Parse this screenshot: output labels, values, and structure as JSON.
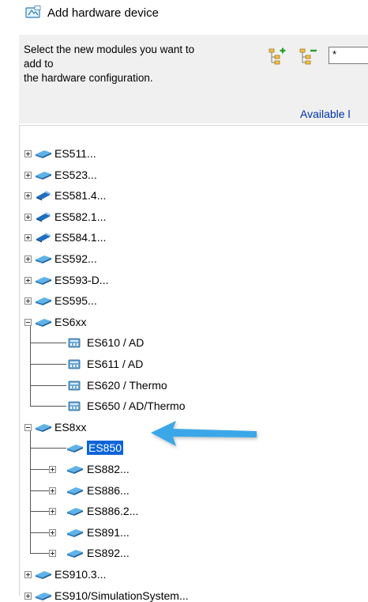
{
  "window": {
    "title": "Add hardware device"
  },
  "header": {
    "instruction_lines": [
      "Select the new modules you want to",
      "add to",
      "the hardware configuration."
    ],
    "filter_value": "*",
    "available_label": "Available l"
  },
  "toolbar": {
    "add_icon": "add-module-icon",
    "remove_icon": "remove-module-icon"
  },
  "tree": {
    "items": [
      {
        "label": "ES511...",
        "level": 0,
        "expander": "plus",
        "icon": "module-icon",
        "selected": false
      },
      {
        "label": "ES523...",
        "level": 0,
        "expander": "plus",
        "icon": "module-icon",
        "selected": false
      },
      {
        "label": "ES581.4...",
        "level": 0,
        "expander": "plus",
        "icon": "usb-module-icon",
        "selected": false
      },
      {
        "label": "ES582.1...",
        "level": 0,
        "expander": "plus",
        "icon": "usb-module-icon",
        "selected": false
      },
      {
        "label": "ES584.1...",
        "level": 0,
        "expander": "plus",
        "icon": "usb-module-icon",
        "selected": false
      },
      {
        "label": "ES592...",
        "level": 0,
        "expander": "plus",
        "icon": "module-icon",
        "selected": false
      },
      {
        "label": "ES593-D...",
        "level": 0,
        "expander": "plus",
        "icon": "module-icon",
        "selected": false
      },
      {
        "label": "ES595...",
        "level": 0,
        "expander": "plus",
        "icon": "module-icon",
        "selected": false
      },
      {
        "label": "ES6xx",
        "level": 0,
        "expander": "minus",
        "icon": "module-icon",
        "selected": false
      },
      {
        "label": "ES610 / AD",
        "level": 1,
        "expander": "none",
        "icon": "measurement-module-icon",
        "selected": false
      },
      {
        "label": "ES611 / AD",
        "level": 1,
        "expander": "none",
        "icon": "measurement-module-icon",
        "selected": false
      },
      {
        "label": "ES620 / Thermo",
        "level": 1,
        "expander": "none",
        "icon": "measurement-module-icon",
        "selected": false
      },
      {
        "label": "ES650 / AD/Thermo",
        "level": 1,
        "expander": "none",
        "icon": "measurement-module-icon",
        "selected": false
      },
      {
        "label": "ES8xx",
        "level": 0,
        "expander": "minus",
        "icon": "module-icon",
        "selected": false
      },
      {
        "label": "ES850",
        "level": 1,
        "expander": "none",
        "icon": "module-icon",
        "selected": true
      },
      {
        "label": "ES882...",
        "level": 1,
        "expander": "plus",
        "icon": "module-icon",
        "selected": false
      },
      {
        "label": "ES886...",
        "level": 1,
        "expander": "plus",
        "icon": "module-icon",
        "selected": false
      },
      {
        "label": "ES886.2...",
        "level": 1,
        "expander": "plus",
        "icon": "module-icon",
        "selected": false
      },
      {
        "label": "ES891...",
        "level": 1,
        "expander": "plus",
        "icon": "module-icon",
        "selected": false
      },
      {
        "label": "ES892...",
        "level": 1,
        "expander": "plus",
        "icon": "module-icon",
        "selected": false
      },
      {
        "label": "ES910.3...",
        "level": 0,
        "expander": "plus",
        "icon": "module-icon",
        "selected": false
      },
      {
        "label": "ES910/SimulationSystem...",
        "level": 0,
        "expander": "plus",
        "icon": "module-icon",
        "selected": false
      }
    ]
  },
  "colors": {
    "selection": "#0a64d8",
    "arrow": "#3aa7e8",
    "available_link": "#0033aa"
  }
}
